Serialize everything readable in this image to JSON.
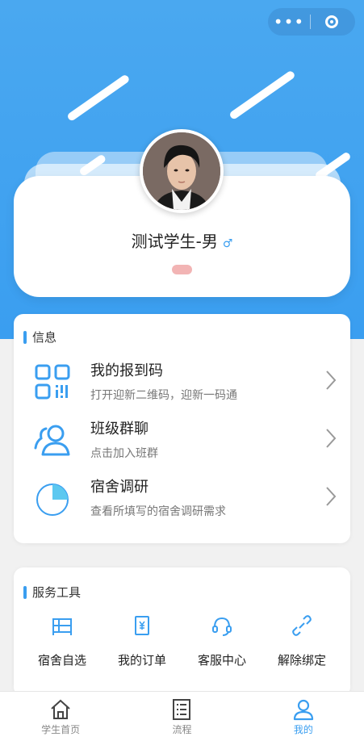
{
  "colors": {
    "primary": "#3a9ef0",
    "accent_pill": "#f2b4b4"
  },
  "capsule": {
    "more_icon": "more-dots-icon",
    "close_icon": "record-circle-icon",
    "dots": "•••"
  },
  "profile": {
    "name": "测试学生-男",
    "gender_icon": "male-symbol-icon",
    "gender_glyph": "♂"
  },
  "info_section": {
    "title": "信息",
    "items": [
      {
        "title": "我的报到码",
        "subtitle": "打开迎新二维码，迎新一码通",
        "icon": "qr-code-icon"
      },
      {
        "title": "班级群聊",
        "subtitle": "点击加入班群",
        "icon": "group-users-icon"
      },
      {
        "title": "宿舍调研",
        "subtitle": "查看所填写的宿舍调研需求",
        "icon": "pie-chart-icon"
      }
    ]
  },
  "tools_section": {
    "title": "服务工具",
    "items": [
      {
        "label": "宿舍自选",
        "icon": "bed-icon"
      },
      {
        "label": "我的订单",
        "icon": "order-receipt-icon"
      },
      {
        "label": "客服中心",
        "icon": "headset-icon"
      },
      {
        "label": "解除绑定",
        "icon": "unlink-icon"
      }
    ]
  },
  "tabbar": {
    "items": [
      {
        "label": "学生首页",
        "icon": "home-icon",
        "active": false
      },
      {
        "label": "流程",
        "icon": "checklist-icon",
        "active": false
      },
      {
        "label": "我的",
        "icon": "user-icon",
        "active": true
      }
    ]
  }
}
